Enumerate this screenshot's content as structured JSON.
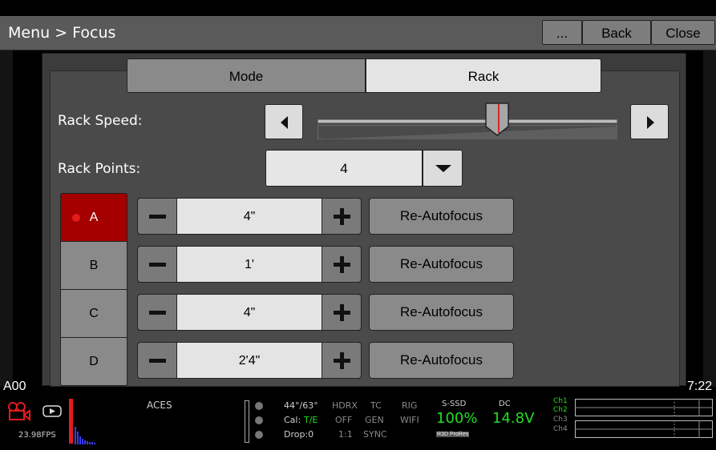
{
  "header": {
    "title": "Menu > Focus",
    "more_label": "...",
    "back_label": "Back",
    "close_label": "Close"
  },
  "background": {
    "left_text": "A00",
    "right_text": "7:22"
  },
  "tabs": [
    {
      "label": "Mode",
      "selected": false
    },
    {
      "label": "Rack",
      "selected": true
    }
  ],
  "rack_speed": {
    "label": "Rack Speed:",
    "level": 0.6
  },
  "rack_points": {
    "label": "Rack Points:",
    "selected": "4"
  },
  "points": [
    {
      "name": "A",
      "distance": "4\"",
      "button": "Re-Autofocus",
      "active": true
    },
    {
      "name": "B",
      "distance": "1'",
      "button": "Re-Autofocus",
      "active": false
    },
    {
      "name": "C",
      "distance": "4\"",
      "button": "Re-Autofocus",
      "active": false
    },
    {
      "name": "D",
      "distance": "2'4\"",
      "button": "Re-Autofocus",
      "active": false
    }
  ],
  "status": {
    "fps": "23.98FPS",
    "color_space": "ACES",
    "temp": "44°/63°",
    "cal_label": "Cal:",
    "cal_value": "T/E",
    "drop": "Drop:0",
    "hdrx": "HDRX",
    "hdrx_val": "OFF",
    "ratio": "1:1",
    "tc": "TC",
    "tc_val": "GEN",
    "tc_sync": "SYNC",
    "rig": "RIG",
    "rig_val": "WIFI",
    "media_label": "S-SSD",
    "media_value": "100%",
    "r3d_badge": "R3D",
    "prores_badge": "ProRes",
    "power_label": "DC",
    "power_value": "14.8V",
    "channels": [
      "Ch1",
      "Ch2",
      "Ch3",
      "Ch4"
    ],
    "colors": {
      "green": "#22dd22",
      "red": "#e31b1b",
      "active_red": "#a50000"
    }
  }
}
